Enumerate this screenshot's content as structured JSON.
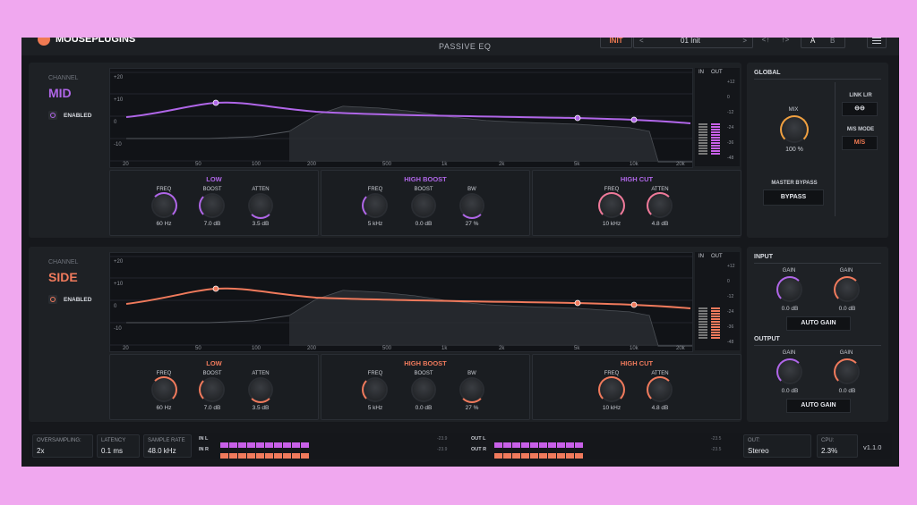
{
  "app": {
    "brand": "MOUSEPLUGINS",
    "subtitle": "PASSIVE EQ"
  },
  "toolbar": {
    "init": "INIT",
    "prev": "<",
    "next": ">",
    "preset": "01 Init",
    "undo": "<↑",
    "redo": "↑>",
    "a": "A",
    "b": "B"
  },
  "mid": {
    "label": "CHANNEL",
    "name": "MID",
    "enabled": "ENABLED",
    "accent": "#b066e8",
    "graph": {
      "db_ticks": [
        "+20",
        "+10",
        "0",
        "-10",
        "-20"
      ],
      "freq_ticks": [
        "20",
        "50",
        "100",
        "200",
        "500",
        "1k",
        "2k",
        "5k",
        "10k",
        "20k"
      ],
      "meter_ticks": [
        "+12",
        "0",
        "-12",
        "-24",
        "-36",
        "-48"
      ],
      "in": "IN",
      "out": "OUT"
    },
    "low": {
      "title": "LOW",
      "k1": "FREQ",
      "v1": "60 Hz",
      "k2": "BOOST",
      "v2": "7.0 dB",
      "k3": "ATTEN",
      "v3": "3.5 dB"
    },
    "hb": {
      "title": "HIGH BOOST",
      "k1": "FREQ",
      "v1": "5 kHz",
      "k2": "BOOST",
      "v2": "0.0 dB",
      "k3": "BW",
      "v3": "27 %"
    },
    "hc": {
      "title": "HIGH CUT",
      "k1": "FREQ",
      "v1": "10 kHz",
      "k2": "ATTEN",
      "v2": "4.8 dB"
    }
  },
  "side": {
    "label": "CHANNEL",
    "name": "SIDE",
    "enabled": "ENABLED",
    "accent": "#f07a5c",
    "graph": {
      "db_ticks": [
        "+20",
        "+10",
        "0",
        "-10",
        "-20"
      ],
      "freq_ticks": [
        "20",
        "50",
        "100",
        "200",
        "500",
        "1k",
        "2k",
        "5k",
        "10k",
        "20k"
      ],
      "meter_ticks": [
        "+12",
        "0",
        "-12",
        "-24",
        "-36",
        "-48"
      ],
      "in": "IN",
      "out": "OUT"
    },
    "low": {
      "title": "LOW",
      "k1": "FREQ",
      "v1": "60 Hz",
      "k2": "BOOST",
      "v2": "7.0 dB",
      "k3": "ATTEN",
      "v3": "3.5 dB"
    },
    "hb": {
      "title": "HIGH BOOST",
      "k1": "FREQ",
      "v1": "5 kHz",
      "k2": "BOOST",
      "v2": "0.0 dB",
      "k3": "BW",
      "v3": "27 %"
    },
    "hc": {
      "title": "HIGH CUT",
      "k1": "FREQ",
      "v1": "10 kHz",
      "k2": "ATTEN",
      "v2": "4.8 dB"
    }
  },
  "global": {
    "title": "GLOBAL",
    "mix_label": "MIX",
    "mix_value": "100 %",
    "link": "LINK L/R",
    "ms_mode": "M/S MODE",
    "ms_value": "M/S",
    "master_bypass": "MASTER BYPASS",
    "bypass": "BYPASS"
  },
  "input": {
    "title": "INPUT",
    "g1": "GAIN",
    "v1": "0.0 dB",
    "g2": "GAIN",
    "v2": "0.0 dB",
    "auto": "AUTO GAIN"
  },
  "output": {
    "title": "OUTPUT",
    "g1": "GAIN",
    "v1": "0.0 dB",
    "g2": "GAIN",
    "v2": "0.0 dB",
    "auto": "AUTO GAIN"
  },
  "status": {
    "oversampling_k": "OVERSAMPLING:",
    "oversampling_v": "2x",
    "latency_k": "LATENCY",
    "latency_v": "0.1 ms",
    "rate_k": "SAMPLE RATE",
    "rate_v": "48.0 kHz",
    "in_l": "IN L",
    "in_r": "IN R",
    "in_l_val": "-23.9",
    "in_r_val": "-23.9",
    "out_l": "OUT L",
    "out_r": "OUT R",
    "out_l_val": "-23.5",
    "out_r_val": "-23.5",
    "out_k": "OUT:",
    "out_v": "Stereo",
    "cpu_k": "CPU:",
    "cpu_v": "2.3%",
    "version": "v1.1.0"
  }
}
